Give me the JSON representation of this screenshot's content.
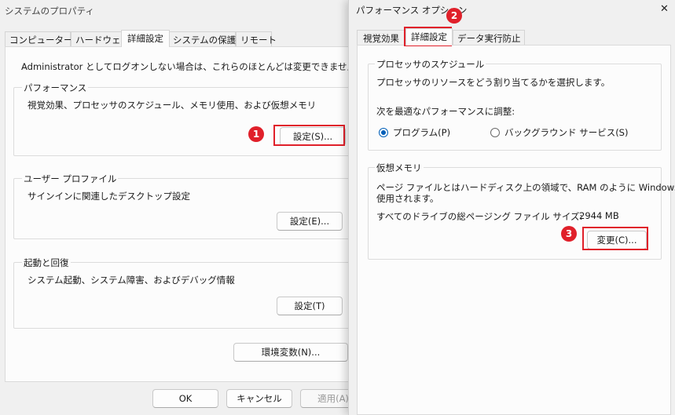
{
  "left_window": {
    "title": "システムのプロパティ",
    "tabs": [
      "コンピューター名",
      "ハードウェア",
      "詳細設定",
      "システムの保護",
      "リモート"
    ],
    "active_tab": "詳細設定",
    "admin_note": "Administrator としてログオンしない場合は、これらのほとんどは変更できません。",
    "performance": {
      "heading": "パフォーマンス",
      "description": "視覚効果、プロセッサのスケジュール、メモリ使用、および仮想メモリ",
      "button": "設定(S)..."
    },
    "user_profile": {
      "heading": "ユーザー プロファイル",
      "description": "サインインに関連したデスクトップ設定",
      "button": "設定(E)..."
    },
    "startup": {
      "heading": "起動と回復",
      "description": "システム起動、システム障害、およびデバッグ情報",
      "button": "設定(T)"
    },
    "env_button": "環境変数(N)...",
    "footer": {
      "ok": "OK",
      "cancel": "キャンセル",
      "apply": "適用(A)"
    }
  },
  "right_window": {
    "title": "パフォーマンス オプション",
    "close_symbol": "✕",
    "tabs": [
      "視覚効果",
      "詳細設定",
      "データ実行防止"
    ],
    "active_tab": "詳細設定",
    "processor": {
      "heading": "プロセッサのスケジュール",
      "description": "プロセッサのリソースをどう割り当てるかを選択します。",
      "adjust_label": "次を最適なパフォーマンスに調整:",
      "option_programs": "プログラム(P)",
      "option_background": "バックグラウンド サービス(S)",
      "selected": "プログラム(P)"
    },
    "virtual_memory": {
      "heading": "仮想メモリ",
      "description_line1": "ページ ファイルとはハードディスク上の領域で、RAM のように Windows で",
      "description_line2": "使用されます。",
      "total_label": "すべてのドライブの総ページング ファイル サイズ:",
      "total_value": "2944 MB",
      "button": "変更(C)..."
    }
  },
  "annotations": {
    "badge1": "1",
    "badge2": "2",
    "badge3": "3"
  },
  "colors": {
    "highlight": "#e0202a",
    "radio_selected": "#005fb8"
  }
}
